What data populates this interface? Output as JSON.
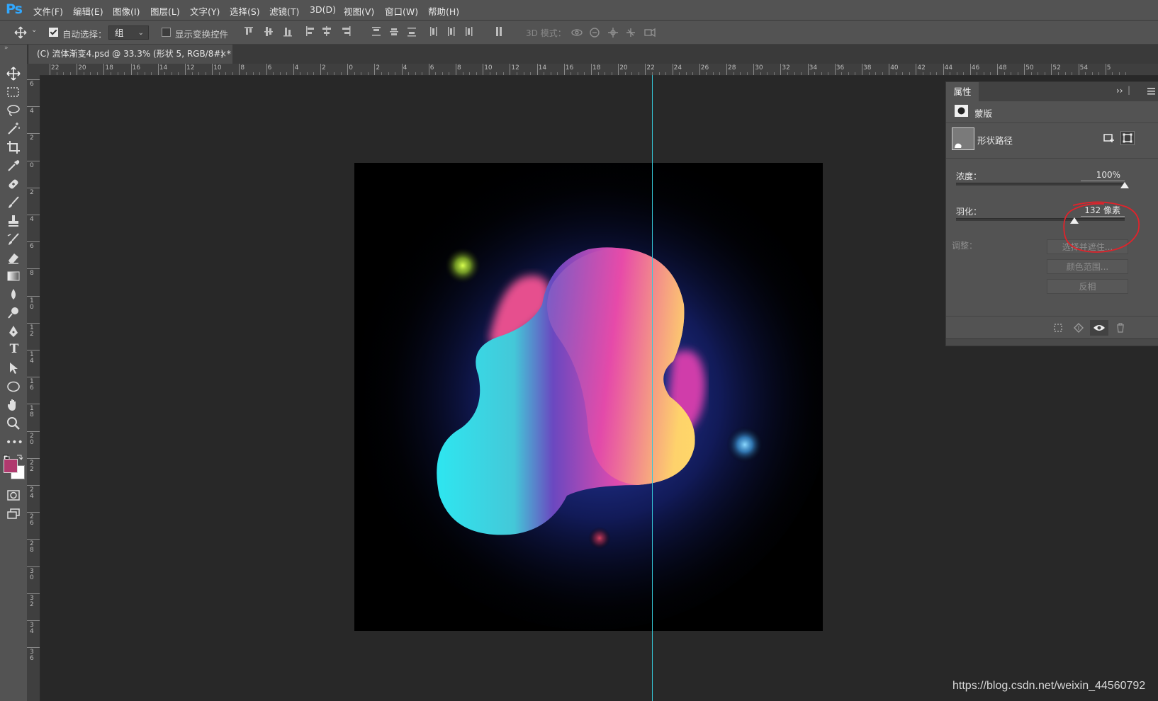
{
  "app": {
    "logo": "Ps"
  },
  "menu": [
    "文件(F)",
    "编辑(E)",
    "图像(I)",
    "图层(L)",
    "文字(Y)",
    "选择(S)",
    "滤镜(T)",
    "3D(D)",
    "视图(V)",
    "窗口(W)",
    "帮助(H)"
  ],
  "options": {
    "auto_select_label": "自动选择：",
    "auto_select_checked": true,
    "auto_select_value": "组",
    "show_transform_label": "显示变换控件",
    "show_transform_checked": false,
    "mode_3d_label": "3D 模式："
  },
  "document": {
    "tab_title": "(C) 流体渐变4.psd @ 33.3% (形状 5, RGB/8#) *",
    "close_glyph": "×"
  },
  "ruler": {
    "h_labels": [
      "22",
      "20",
      "18",
      "16",
      "14",
      "12",
      "10",
      "8",
      "6",
      "4",
      "2",
      "0",
      "2",
      "4",
      "6",
      "8",
      "10",
      "12",
      "14",
      "16",
      "18",
      "20",
      "22",
      "24",
      "26",
      "28",
      "30",
      "32",
      "34",
      "36",
      "38",
      "40",
      "42",
      "44",
      "46",
      "48",
      "50",
      "52",
      "54",
      "5"
    ],
    "v_labels": [
      "6",
      "4",
      "2",
      "0",
      "2",
      "4",
      "6",
      "8",
      "1 0",
      "1 2",
      "1 4",
      "1 6",
      "1 8",
      "2 0",
      "2 2",
      "2 4",
      "2 6",
      "2 8",
      "3 0",
      "3 2",
      "3 4",
      "3 6"
    ]
  },
  "panel": {
    "tab": "属性",
    "mask_label": "蒙版",
    "shape_path_label": "形状路径",
    "density_label": "浓度：",
    "density_value": "100%",
    "density_fraction": 1.0,
    "feather_label": "羽化：",
    "feather_value": "132 像素",
    "feather_fraction": 0.7,
    "refine_label": "调整：",
    "buttons": [
      "选择并遮住...",
      "颜色范围...",
      "反相"
    ]
  },
  "colors": {
    "foreground": "#b03a6e",
    "background": "#ffffff",
    "guide": "#35c8d8",
    "annotation": "#e0232b"
  },
  "watermark": "https://blog.csdn.net/weixin_44560792"
}
